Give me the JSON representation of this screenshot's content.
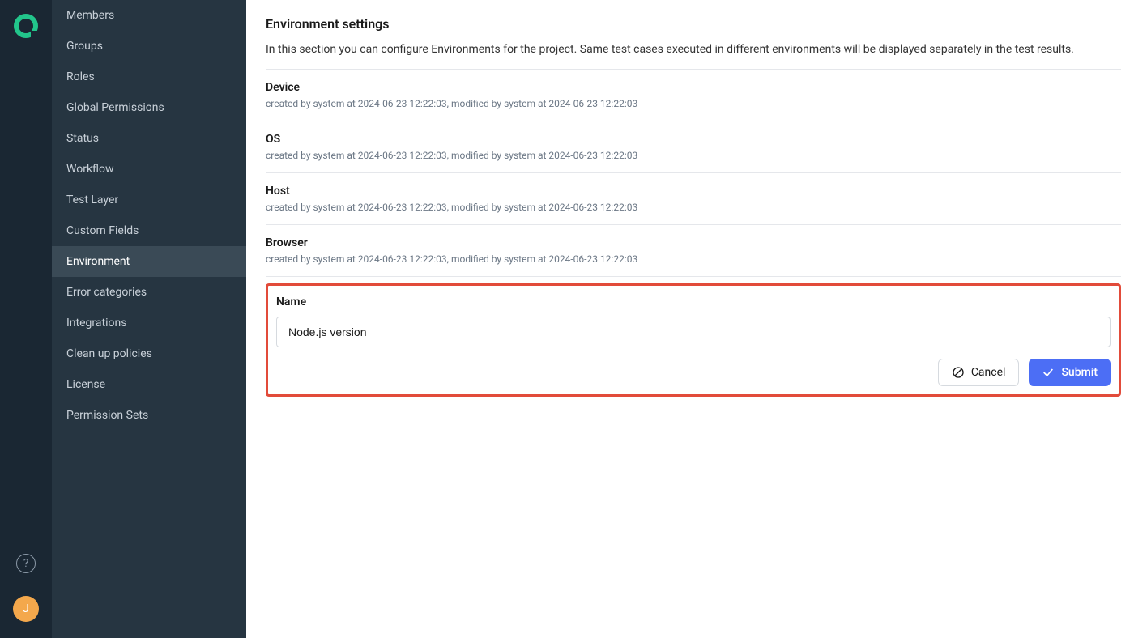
{
  "rail": {
    "help_tooltip": "?",
    "avatar_initial": "J"
  },
  "sidebar": {
    "items": [
      {
        "label": "Members",
        "active": false
      },
      {
        "label": "Groups",
        "active": false
      },
      {
        "label": "Roles",
        "active": false
      },
      {
        "label": "Global Permissions",
        "active": false
      },
      {
        "label": "Status",
        "active": false
      },
      {
        "label": "Workflow",
        "active": false
      },
      {
        "label": "Test Layer",
        "active": false
      },
      {
        "label": "Custom Fields",
        "active": false
      },
      {
        "label": "Environment",
        "active": true
      },
      {
        "label": "Error categories",
        "active": false
      },
      {
        "label": "Integrations",
        "active": false
      },
      {
        "label": "Clean up policies",
        "active": false
      },
      {
        "label": "License",
        "active": false
      },
      {
        "label": "Permission Sets",
        "active": false
      }
    ]
  },
  "main": {
    "title": "Environment settings",
    "description": "In this section you can configure Environments for the project. Same test cases executed in different environments will be displayed separately in the test results.",
    "environments": [
      {
        "name": "Device",
        "meta": "created by system at 2024-06-23 12:22:03, modified by system at 2024-06-23 12:22:03"
      },
      {
        "name": "OS",
        "meta": "created by system at 2024-06-23 12:22:03, modified by system at 2024-06-23 12:22:03"
      },
      {
        "name": "Host",
        "meta": "created by system at 2024-06-23 12:22:03, modified by system at 2024-06-23 12:22:03"
      },
      {
        "name": "Browser",
        "meta": "created by system at 2024-06-23 12:22:03, modified by system at 2024-06-23 12:22:03"
      }
    ],
    "form": {
      "label": "Name",
      "value": "Node.js version",
      "cancel_label": "Cancel",
      "submit_label": "Submit"
    }
  }
}
